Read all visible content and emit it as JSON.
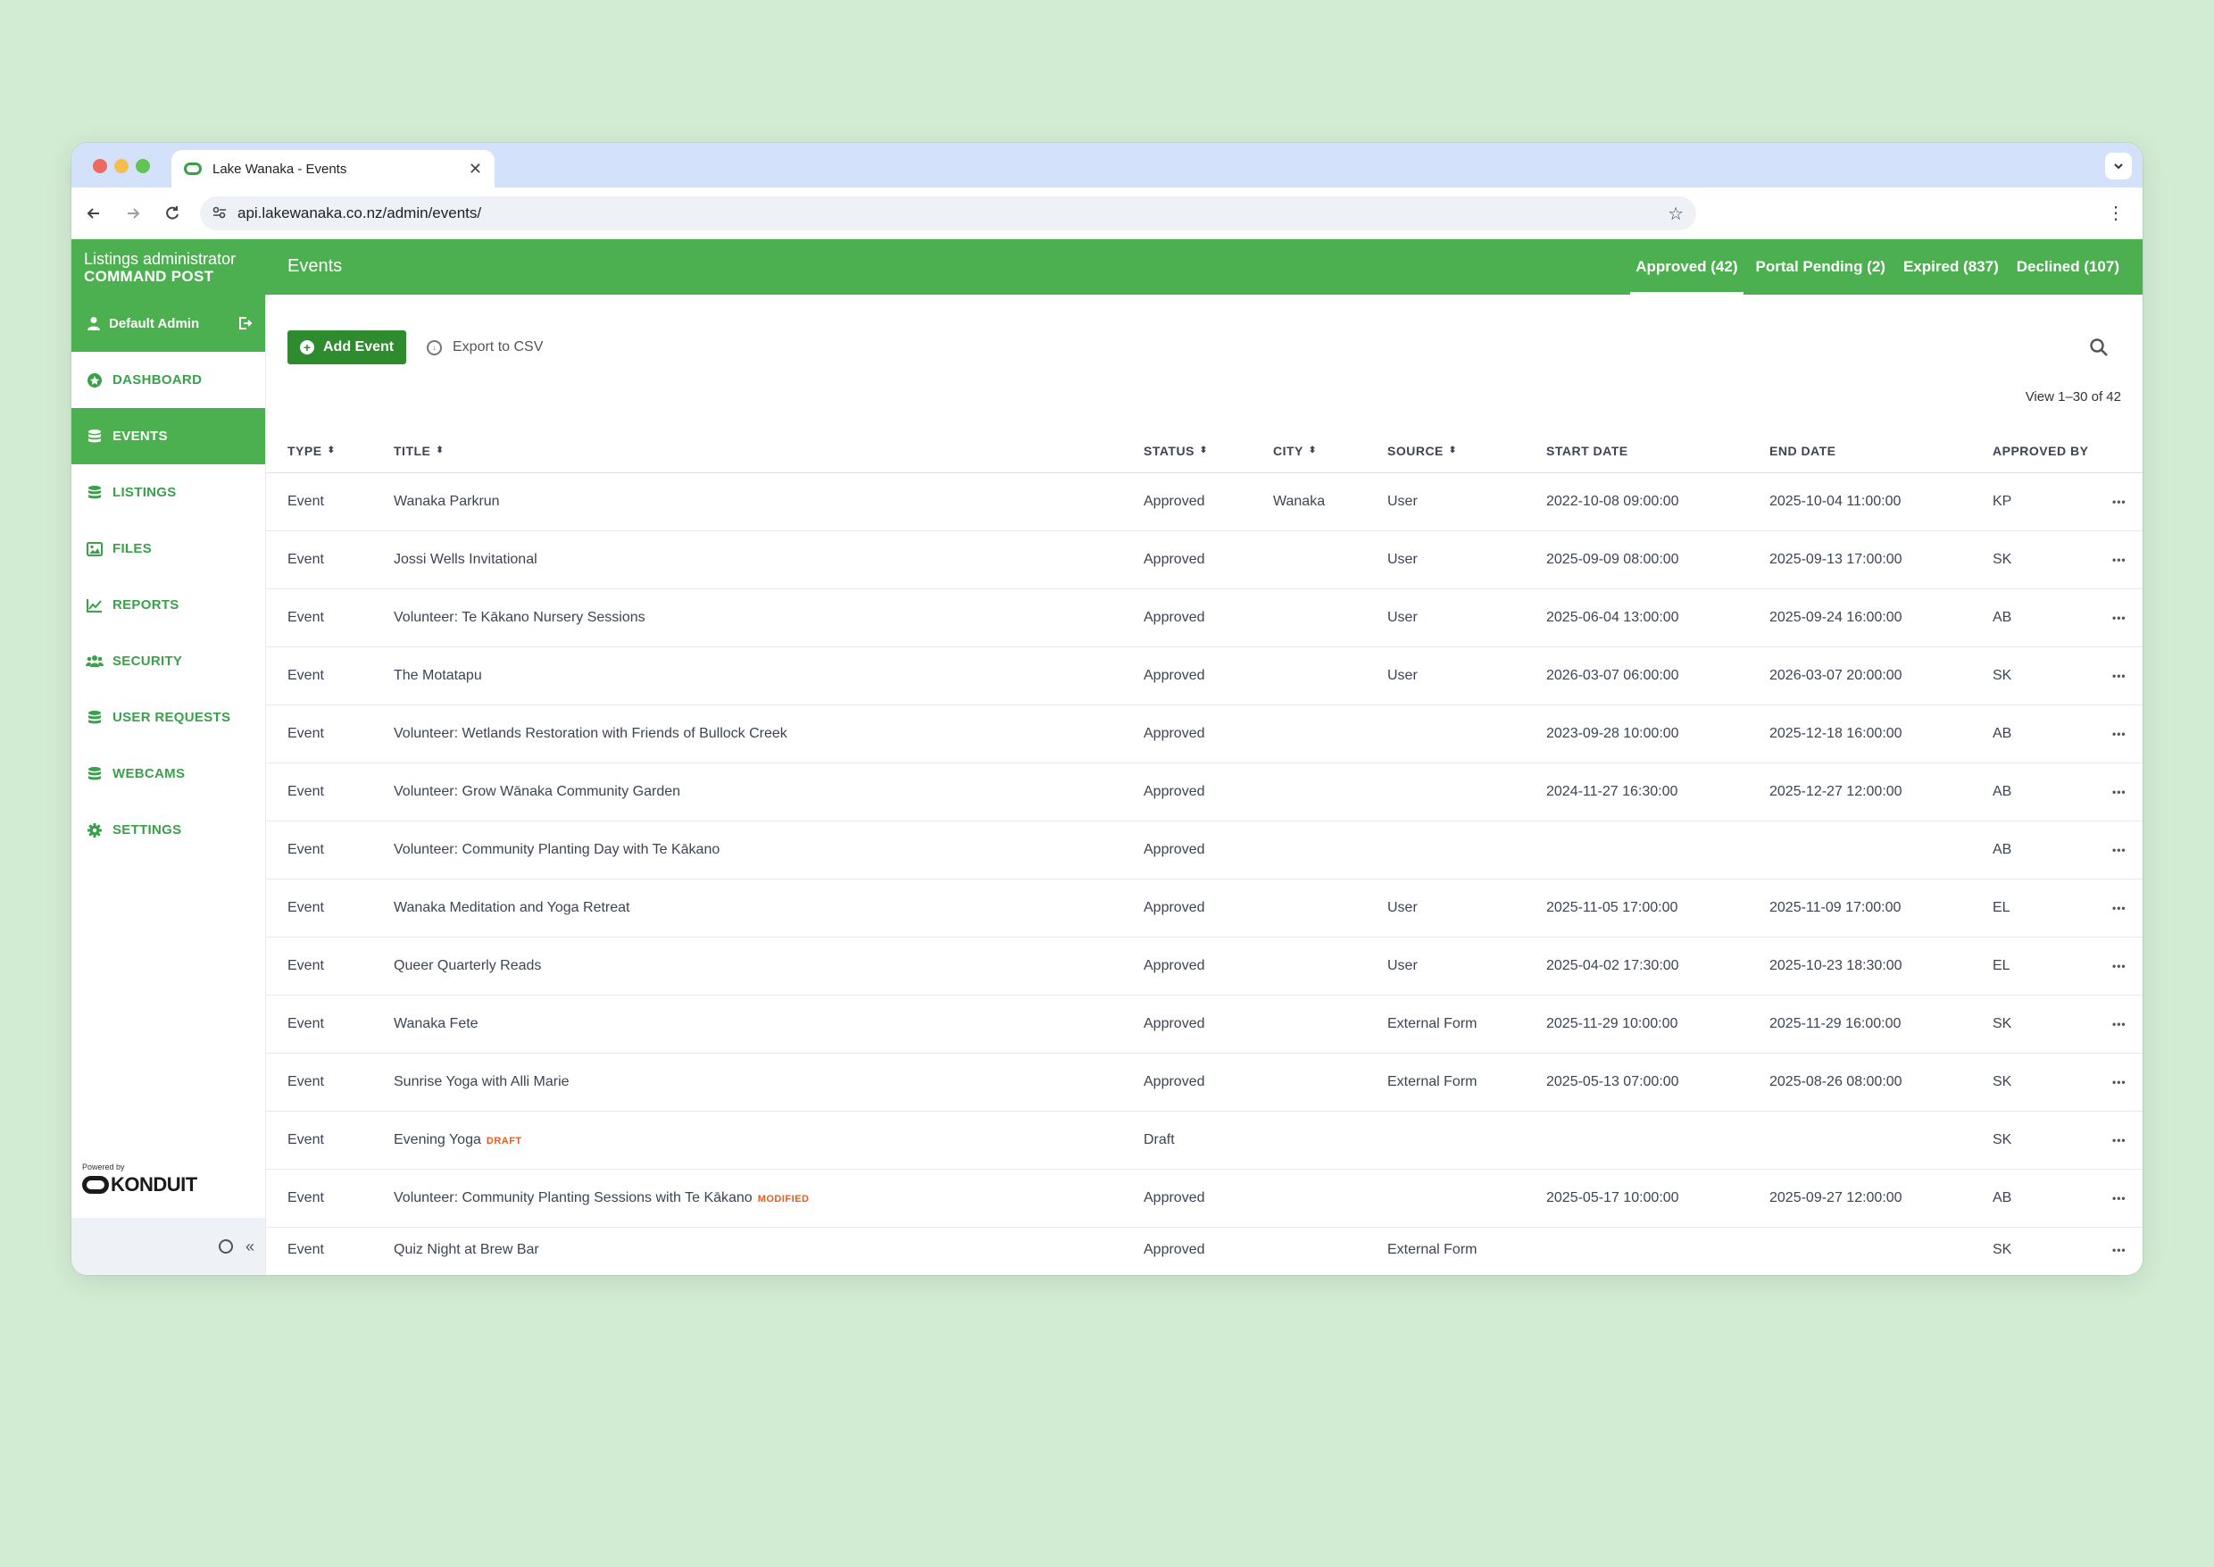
{
  "browser": {
    "tab_title": "Lake Wanaka - Events",
    "url": "api.lakewanaka.co.nz/admin/events/"
  },
  "header": {
    "brand_line1": "Listings administrator",
    "brand_line2": "COMMAND POST",
    "page_title": "Events",
    "status_tabs": [
      {
        "label": "Approved (42)",
        "active": true
      },
      {
        "label": "Portal Pending (2)",
        "active": false
      },
      {
        "label": "Expired (837)",
        "active": false
      },
      {
        "label": "Declined (107)",
        "active": false
      }
    ]
  },
  "sidebar": {
    "user_name": "Default Admin",
    "items": [
      {
        "label": "DASHBOARD",
        "icon": "dashboard-icon"
      },
      {
        "label": "EVENTS",
        "icon": "database-icon",
        "active": true
      },
      {
        "label": "LISTINGS",
        "icon": "database-icon"
      },
      {
        "label": "FILES",
        "icon": "image-icon"
      },
      {
        "label": "REPORTS",
        "icon": "chart-line-icon"
      },
      {
        "label": "SECURITY",
        "icon": "users-icon"
      },
      {
        "label": "USER REQUESTS",
        "icon": "database-icon"
      },
      {
        "label": "WEBCAMS",
        "icon": "database-icon"
      },
      {
        "label": "SETTINGS",
        "icon": "gear-icon"
      }
    ],
    "powered_by": "Powered by",
    "powered_brand": "KONDUIT",
    "collapse_label": "«"
  },
  "main": {
    "add_label": "Add Event",
    "export_label": "Export to CSV",
    "view_count": "View 1–30 of 42"
  },
  "table": {
    "headers": {
      "type": "TYPE",
      "title": "TITLE",
      "status": "STATUS",
      "city": "CITY",
      "source": "SOURCE",
      "start": "START DATE",
      "end": "END DATE",
      "approved_by": "APPROVED BY"
    },
    "rows": [
      {
        "type": "Event",
        "title": "Wanaka Parkrun",
        "tag": "",
        "status": "Approved",
        "city": "Wanaka",
        "source": "User",
        "start": "2022-10-08 09:00:00",
        "end": "2025-10-04 11:00:00",
        "approved_by": "KP"
      },
      {
        "type": "Event",
        "title": "Jossi Wells Invitational",
        "tag": "",
        "status": "Approved",
        "city": "",
        "source": "User",
        "start": "2025-09-09 08:00:00",
        "end": "2025-09-13 17:00:00",
        "approved_by": "SK"
      },
      {
        "type": "Event",
        "title": "Volunteer: Te Kākano Nursery Sessions",
        "tag": "",
        "status": "Approved",
        "city": "",
        "source": "User",
        "start": "2025-06-04 13:00:00",
        "end": "2025-09-24 16:00:00",
        "approved_by": "AB"
      },
      {
        "type": "Event",
        "title": "The Motatapu",
        "tag": "",
        "status": "Approved",
        "city": "",
        "source": "User",
        "start": "2026-03-07 06:00:00",
        "end": "2026-03-07 20:00:00",
        "approved_by": "SK"
      },
      {
        "type": "Event",
        "title": "Volunteer: Wetlands Restoration with Friends of Bullock Creek",
        "tag": "",
        "status": "Approved",
        "city": "",
        "source": "",
        "start": "2023-09-28 10:00:00",
        "end": "2025-12-18 16:00:00",
        "approved_by": "AB"
      },
      {
        "type": "Event",
        "title": "Volunteer: Grow Wānaka Community Garden",
        "tag": "",
        "status": "Approved",
        "city": "",
        "source": "",
        "start": "2024-11-27 16:30:00",
        "end": "2025-12-27 12:00:00",
        "approved_by": "AB"
      },
      {
        "type": "Event",
        "title": "Volunteer: Community Planting Day with Te Kākano",
        "tag": "",
        "status": "Approved",
        "city": "",
        "source": "",
        "start": "",
        "end": "",
        "approved_by": "AB"
      },
      {
        "type": "Event",
        "title": "Wanaka Meditation and Yoga Retreat",
        "tag": "",
        "status": "Approved",
        "city": "",
        "source": "User",
        "start": "2025-11-05 17:00:00",
        "end": "2025-11-09 17:00:00",
        "approved_by": "EL"
      },
      {
        "type": "Event",
        "title": "Queer Quarterly Reads",
        "tag": "",
        "status": "Approved",
        "city": "",
        "source": "User",
        "start": "2025-04-02 17:30:00",
        "end": "2025-10-23 18:30:00",
        "approved_by": "EL"
      },
      {
        "type": "Event",
        "title": "Wanaka Fete",
        "tag": "",
        "status": "Approved",
        "city": "",
        "source": "External Form",
        "start": "2025-11-29 10:00:00",
        "end": "2025-11-29 16:00:00",
        "approved_by": "SK"
      },
      {
        "type": "Event",
        "title": "Sunrise Yoga with Alli Marie",
        "tag": "",
        "status": "Approved",
        "city": "",
        "source": "External Form",
        "start": "2025-05-13 07:00:00",
        "end": "2025-08-26 08:00:00",
        "approved_by": "SK"
      },
      {
        "type": "Event",
        "title": "Evening Yoga",
        "tag": "DRAFT",
        "status": "Draft",
        "city": "",
        "source": "",
        "start": "",
        "end": "",
        "approved_by": "SK"
      },
      {
        "type": "Event",
        "title": "Volunteer: Community Planting Sessions with Te Kākano",
        "tag": "MODIFIED",
        "status": "Approved",
        "city": "",
        "source": "",
        "start": "2025-05-17 10:00:00",
        "end": "2025-09-27 12:00:00",
        "approved_by": "AB"
      },
      {
        "type": "Event",
        "title": "Quiz Night at Brew Bar",
        "tag": "",
        "status": "Approved",
        "city": "",
        "source": "External Form",
        "start": "",
        "end": "",
        "approved_by": "SK"
      }
    ]
  }
}
